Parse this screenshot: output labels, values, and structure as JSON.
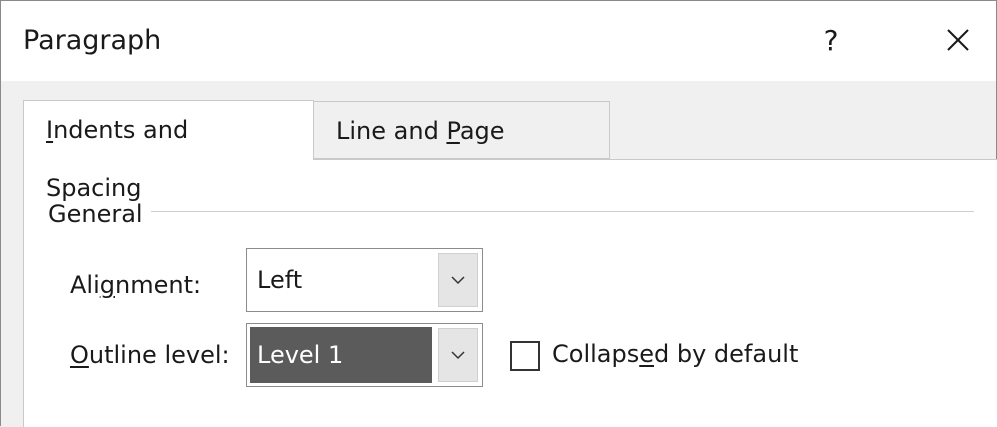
{
  "dialog": {
    "title": "Paragraph",
    "help_label": "?",
    "close_icon": "close-icon"
  },
  "tabs": [
    {
      "label": "Indents and Spacing",
      "access_key": "I",
      "active": true
    },
    {
      "label": "Line and Page Breaks",
      "access_key": "P",
      "active": false
    }
  ],
  "general": {
    "group_label": "General",
    "alignment": {
      "label": "Alignment:",
      "access_key": "g",
      "value": "Left"
    },
    "outline_level": {
      "label": "Outline level:",
      "access_key": "O",
      "value": "Level 1"
    },
    "collapsed": {
      "label": "Collapsed by default",
      "access_key": "e",
      "checked": false
    }
  },
  "colors": {
    "selection": "#5b5b5b",
    "dialog_bg": "#f0f0f0",
    "panel_bg": "#ffffff"
  }
}
